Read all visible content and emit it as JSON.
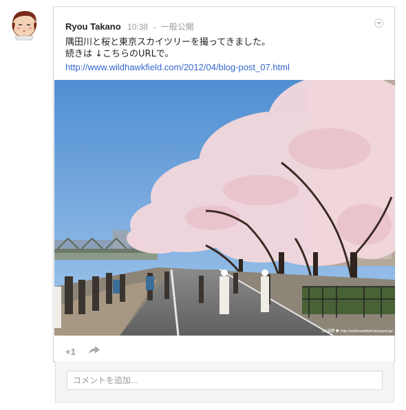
{
  "post": {
    "author": "Ryou Takano",
    "time": "10:38",
    "separator": "-",
    "visibility": "一般公開",
    "text_line1": "隅田川と桜と東京スカイツリーを撮ってきました。",
    "text_line2": "続きは ↓こちらのURLで。",
    "link": "http://www.wildhawkfield.com/2012/04/blog-post_07.html",
    "photo_watermark": "(C)高野 ▶ http://wildhawkfield.blogspot.jp/"
  },
  "actions": {
    "plus_one": "+1",
    "share_icon": "share-icon"
  },
  "comment": {
    "placeholder": "コメントを追加..."
  },
  "colors": {
    "link": "#3366cc",
    "sky": "#6aa4dc",
    "blossom": "#f1d6dc"
  }
}
